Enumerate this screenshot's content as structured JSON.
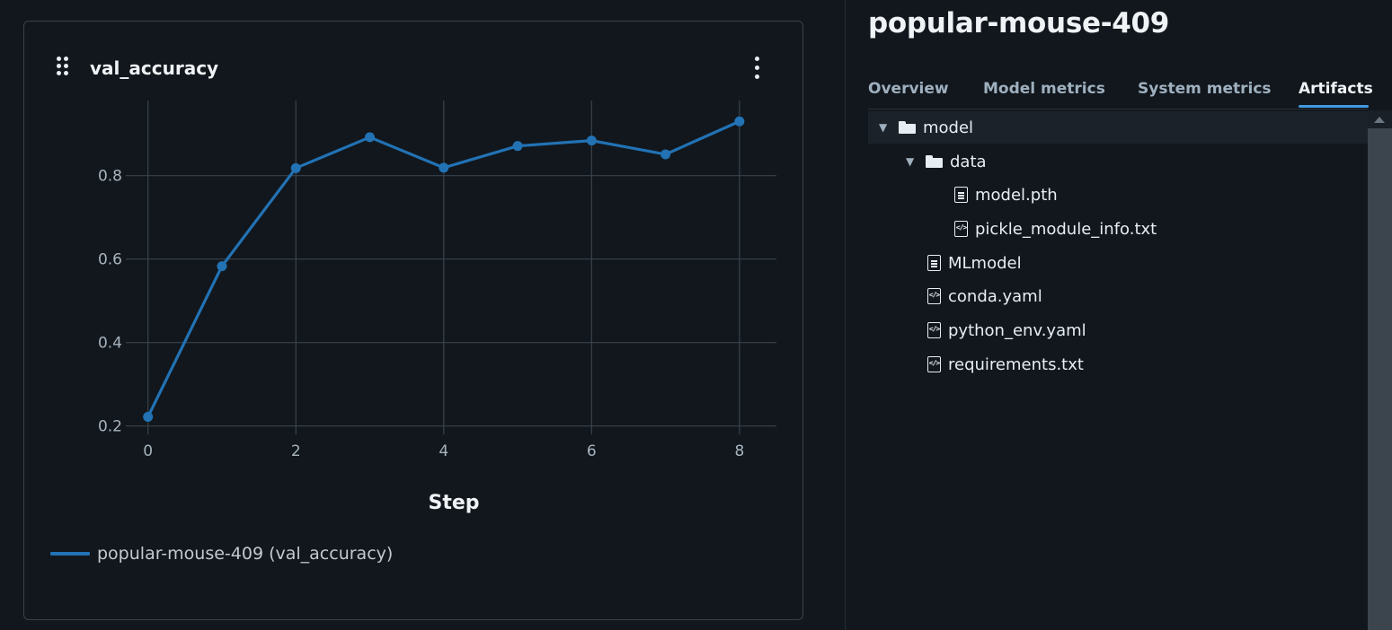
{
  "chart_panel": {
    "title": "val_accuracy",
    "legend_label": "popular-mouse-409 (val_accuracy)"
  },
  "chart_data": {
    "type": "line",
    "title": "val_accuracy",
    "xlabel": "Step",
    "ylabel": "",
    "x": [
      0,
      1,
      2,
      3,
      4,
      5,
      6,
      7,
      8
    ],
    "series": [
      {
        "name": "popular-mouse-409 (val_accuracy)",
        "values": [
          0.222,
          0.583,
          0.818,
          0.892,
          0.819,
          0.871,
          0.884,
          0.851,
          0.93
        ],
        "color": "#2272b4"
      }
    ],
    "xticks": [
      0,
      2,
      4,
      6,
      8
    ],
    "yticks": [
      0.2,
      0.4,
      0.6,
      0.8
    ],
    "xlim": [
      -0.3,
      8.5
    ],
    "ylim": [
      0.18,
      0.98
    ],
    "grid": true,
    "legend_position": "bottom-left"
  },
  "run": {
    "title": "popular-mouse-409",
    "tabs": [
      {
        "label": "Overview"
      },
      {
        "label": "Model metrics"
      },
      {
        "label": "System metrics"
      },
      {
        "label": "Artifacts",
        "active": true
      }
    ]
  },
  "artifacts": {
    "items": [
      {
        "label": "model",
        "type": "folder",
        "expanded": true,
        "depth": 0
      },
      {
        "label": "data",
        "type": "folder",
        "expanded": true,
        "depth": 1
      },
      {
        "label": "model.pth",
        "type": "file",
        "depth": 2
      },
      {
        "label": "pickle_module_info.txt",
        "type": "code-file",
        "depth": 2
      },
      {
        "label": "MLmodel",
        "type": "file",
        "depth": 1
      },
      {
        "label": "conda.yaml",
        "type": "code-file",
        "depth": 1
      },
      {
        "label": "python_env.yaml",
        "type": "code-file",
        "depth": 1
      },
      {
        "label": "requirements.txt",
        "type": "code-file",
        "depth": 1
      }
    ]
  },
  "colors": {
    "background": "#11171d",
    "accent": "#4299e0",
    "series": "#2272b4"
  }
}
